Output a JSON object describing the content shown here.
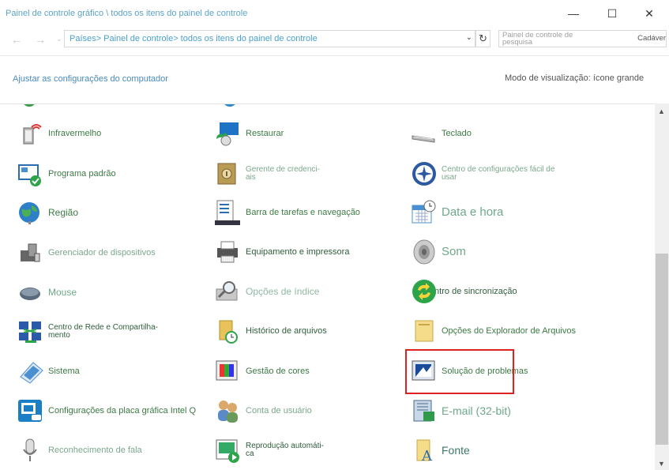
{
  "window": {
    "title": "Painel de controle gráfico \\ todos os itens do painel de controle",
    "minimize_glyph": "—",
    "maximize_glyph": "☐",
    "close_glyph": "✕"
  },
  "nav": {
    "back_glyph": "←",
    "forward_glyph": "→",
    "recent_glyph": "⌄",
    "breadcrumbs": [
      "Países",
      "Painel de controle",
      "todos os itens do painel de controle"
    ],
    "dropdown_glyph": "⌄",
    "refresh_glyph": "↻"
  },
  "search": {
    "placeholder": "Painel de controle de pesquisa",
    "button": "Cadáver"
  },
  "header": {
    "adjust_label": "Ajustar as configurações do computador",
    "view_mode_label": "Modo de visualização:",
    "view_mode_value": "ícone grande"
  },
  "items": {
    "col1": [
      {
        "label": "Infravermelho",
        "icon": "infrared-icon"
      },
      {
        "label": "Programa padrão",
        "icon": "default-programs-icon"
      },
      {
        "label": "Região",
        "icon": "region-globe-icon"
      },
      {
        "label": "Gerenciador de dispositivos",
        "icon": "device-manager-icon"
      },
      {
        "label": "Mouse",
        "icon": "mouse-icon"
      },
      {
        "label": "Centro de Rede e Compartilha-\nmento",
        "icon": "network-center-icon"
      },
      {
        "label": "Sistema",
        "icon": "system-icon"
      },
      {
        "label": "Configurações da placa gráfica Intel Q",
        "icon": "intel-graphics-icon"
      },
      {
        "label": "Reconhecimento de fala",
        "icon": "microphone-icon"
      }
    ],
    "col2": [
      {
        "label": "Restaurar",
        "icon": "restore-icon"
      },
      {
        "label": "Gerente de credenci-\nais",
        "icon": "credential-vault-icon"
      },
      {
        "label": "Barra de tarefas e navegação",
        "icon": "taskbar-icon"
      },
      {
        "label": "Equipamento e impressora",
        "icon": "printer-icon"
      },
      {
        "label": "Opções de índice",
        "icon": "indexing-icon"
      },
      {
        "label": "Histórico de arquivos",
        "icon": "file-history-icon"
      },
      {
        "label": "Gestão de cores",
        "icon": "color-management-icon"
      },
      {
        "label": "Conta de usuário",
        "icon": "user-accounts-icon"
      },
      {
        "label": "Reprodução automáti-\nca",
        "icon": "autoplay-icon"
      }
    ],
    "col3": [
      {
        "label": "Teclado",
        "icon": "keyboard-icon"
      },
      {
        "label": "Centro de configurações fácil de\nusar",
        "icon": "ease-of-access-icon"
      },
      {
        "label": "Data e hora",
        "icon": "calendar-clock-icon"
      },
      {
        "label": "Som",
        "icon": "speaker-icon"
      },
      {
        "label": "Centro de sincronização",
        "icon": "sync-center-icon"
      },
      {
        "label": "Opções do Explorador de Arquivos",
        "icon": "folder-options-icon"
      },
      {
        "label": "Solução de problemas",
        "icon": "troubleshooting-icon"
      },
      {
        "label": "E-mail (32-bit)",
        "icon": "mail-icon"
      },
      {
        "label": "Fonte",
        "icon": "fonts-icon"
      }
    ]
  },
  "scroll": {
    "up_glyph": "▲",
    "down_glyph": "▼"
  }
}
